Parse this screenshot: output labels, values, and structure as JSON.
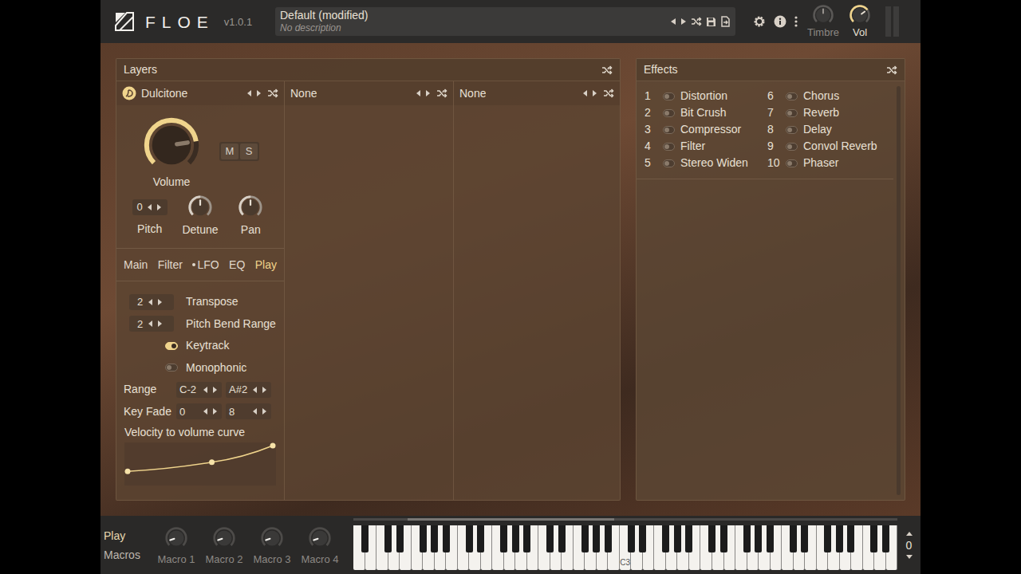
{
  "header": {
    "logo": "FLOE",
    "version": "v1.0.1",
    "preset": {
      "name": "Default (modified)",
      "description": "No description"
    },
    "knobs": [
      {
        "label": "Timbre",
        "level": 0.5,
        "active": false
      },
      {
        "label": "Vol",
        "level": 0.7,
        "active": true
      }
    ],
    "meter_level": 0
  },
  "layers": {
    "title": "Layers",
    "slots": [
      {
        "name": "Dulcitone",
        "loaded": true
      },
      {
        "name": "None",
        "loaded": false
      },
      {
        "name": "None",
        "loaded": false
      }
    ]
  },
  "layer": {
    "volume": {
      "label": "Volume",
      "level": 0.8
    },
    "mute": {
      "label": "M",
      "on": false
    },
    "solo": {
      "label": "S",
      "on": false
    },
    "pitch": {
      "label": "Pitch",
      "value": "0"
    },
    "detune": {
      "label": "Detune",
      "level": 0.5
    },
    "pan": {
      "label": "Pan",
      "level": 0.5
    },
    "tabs": [
      {
        "label": "Main",
        "selected": false,
        "indicator": false
      },
      {
        "label": "Filter",
        "selected": false,
        "indicator": false
      },
      {
        "label": "LFO",
        "selected": false,
        "indicator": true
      },
      {
        "label": "EQ",
        "selected": false,
        "indicator": false
      },
      {
        "label": "Play",
        "selected": true,
        "indicator": false
      }
    ],
    "play": {
      "rows": [
        {
          "kind": "stepper",
          "value": "2",
          "label": "Transpose"
        },
        {
          "kind": "stepper",
          "value": "2",
          "label": "Pitch Bend Range"
        },
        {
          "kind": "toggle",
          "label": "Keytrack",
          "on": true
        },
        {
          "kind": "toggle",
          "label": "Monophonic",
          "on": false
        },
        {
          "kind": "pair",
          "label": "Range",
          "values": [
            "C-2",
            "A#2"
          ]
        },
        {
          "kind": "pair",
          "label": "Key Fade",
          "values": [
            "0",
            "8"
          ]
        }
      ],
      "curve": {
        "label": "Velocity to volume curve",
        "points": [
          [
            0,
            0.3
          ],
          [
            0.58,
            0.55
          ],
          [
            1,
            1
          ]
        ]
      }
    }
  },
  "effects": {
    "title": "Effects",
    "items": [
      {
        "number": "1",
        "name": "Distortion",
        "on": false
      },
      {
        "number": "2",
        "name": "Bit Crush",
        "on": false
      },
      {
        "number": "3",
        "name": "Compressor",
        "on": false
      },
      {
        "number": "4",
        "name": "Filter",
        "on": false
      },
      {
        "number": "5",
        "name": "Stereo Widen",
        "on": false
      },
      {
        "number": "6",
        "name": "Chorus",
        "on": false
      },
      {
        "number": "7",
        "name": "Reverb",
        "on": false
      },
      {
        "number": "8",
        "name": "Delay",
        "on": false
      },
      {
        "number": "9",
        "name": "Convol Reverb",
        "on": false
      },
      {
        "number": "10",
        "name": "Phaser",
        "on": false
      }
    ]
  },
  "bottom": {
    "modes": [
      {
        "label": "Play",
        "selected": true
      },
      {
        "label": "Macros",
        "selected": false
      }
    ],
    "macros": [
      {
        "label": "Macro 1",
        "level": 0.1
      },
      {
        "label": "Macro 2",
        "level": 0.1
      },
      {
        "label": "Macro 3",
        "level": 0.1
      },
      {
        "label": "Macro 4",
        "level": 0.1
      }
    ],
    "keyboard": {
      "note_label": "C3",
      "octave": "0",
      "visible_range": {
        "start": 0.1,
        "end": 0.48
      }
    }
  }
}
